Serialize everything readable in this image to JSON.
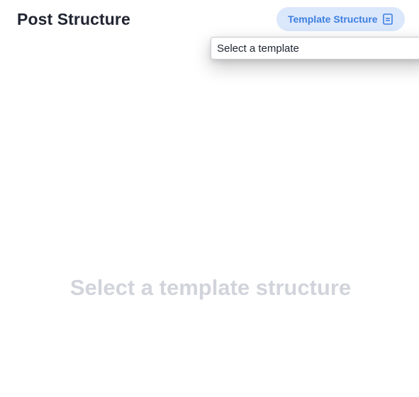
{
  "header": {
    "title": "Post Structure",
    "template_button_label": "Template Structure",
    "template_button_icon": "document-icon"
  },
  "template_select": {
    "selected_value": "Select a template"
  },
  "main": {
    "empty_state_text": "Select a template structure"
  },
  "colors": {
    "accent": "#3d7fe0",
    "button_background": "#dbe7fb",
    "empty_state_text": "#d2d4dc",
    "title_text": "#1f2430"
  }
}
